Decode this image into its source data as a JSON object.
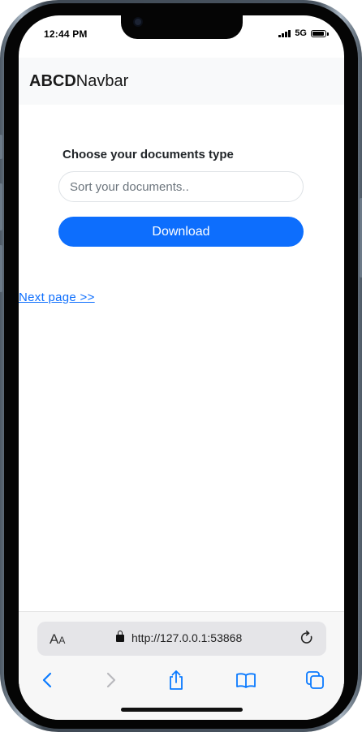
{
  "status_bar": {
    "time": "12:44 PM",
    "network": "5G"
  },
  "navbar": {
    "brand_bold": "ABCD",
    "brand_rest": "Navbar"
  },
  "form": {
    "label": "Choose your documents type",
    "input_placeholder": "Sort your documents..",
    "input_value": "",
    "button_label": "Download"
  },
  "link": {
    "next_label": "Next page >>"
  },
  "browser": {
    "aa_large": "A",
    "aa_small": "A",
    "url": "http://127.0.0.1:53868"
  },
  "colors": {
    "accent": "#0d6efd",
    "navbar_bg": "#f8f9fa",
    "url_bar_bg": "#e5e5e8"
  },
  "icons": [
    "camera-icon",
    "signal-icon",
    "battery-icon",
    "lock-icon",
    "reload-icon",
    "back-icon",
    "forward-icon",
    "share-icon",
    "bookmarks-icon",
    "tabs-icon"
  ]
}
